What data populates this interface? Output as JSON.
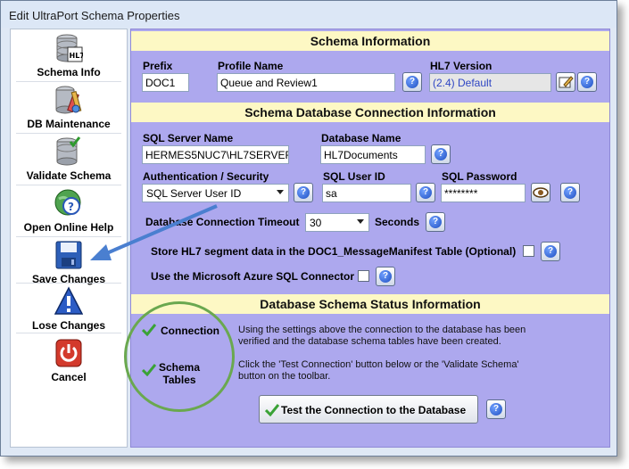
{
  "window": {
    "title": "Edit UltraPort Schema Properties"
  },
  "toolbar": {
    "items": [
      {
        "label": "Schema Info",
        "icon": "database-hl7-icon"
      },
      {
        "label": "DB Maintenance",
        "icon": "database-tools-icon"
      },
      {
        "label": "Validate Schema",
        "icon": "database-check-icon"
      },
      {
        "label": "Open Online Help",
        "icon": "help-globe-icon"
      },
      {
        "label": "Save Changes",
        "icon": "floppy-disk-icon"
      },
      {
        "label": "Lose Changes",
        "icon": "warning-icon"
      },
      {
        "label": "Cancel",
        "icon": "power-icon"
      }
    ]
  },
  "schema_info": {
    "header": "Schema Information",
    "prefix_label": "Prefix",
    "prefix_value": "DOC1",
    "profile_label": "Profile Name",
    "profile_value": "Queue and Review1",
    "hl7_label": "HL7 Version",
    "hl7_value": "(2.4) Default"
  },
  "connection": {
    "header": "Schema Database Connection Information",
    "server_label": "SQL Server Name",
    "server_value": "HERMES5NUC7\\HL7SERVER",
    "dbname_label": "Database Name",
    "dbname_value": "HL7Documents",
    "auth_label": "Authentication / Security",
    "auth_value": "SQL Server User ID",
    "userid_label": "SQL User ID",
    "userid_value": "sa",
    "password_label": "SQL Password",
    "password_value": "********",
    "timeout_label": "Database Connection Timeout",
    "timeout_value": "30",
    "timeout_unit": "Seconds",
    "store_label": "Store HL7 segment data in the DOC1_MessageManifest Table (Optional)",
    "azure_label": "Use the Microsoft Azure SQL Connector"
  },
  "status": {
    "header": "Database Schema Status Information",
    "connection_label": "Connection",
    "tables_label_line1": "Schema",
    "tables_label_line2": "Tables",
    "message_line1": "Using the settings above the connection to the database has been",
    "message_line2": "verified and the database schema tables have been created.",
    "hint_line1": "Click the 'Test Connection' button below or the 'Validate Schema'",
    "hint_line2": "button on the toolbar.",
    "test_button": "Test the Connection to the Database"
  },
  "colors": {
    "panel": "#ada8ee",
    "header": "#fdf8c4",
    "accent_arrow": "#4a7fd0",
    "ok_green": "#3aa236"
  }
}
